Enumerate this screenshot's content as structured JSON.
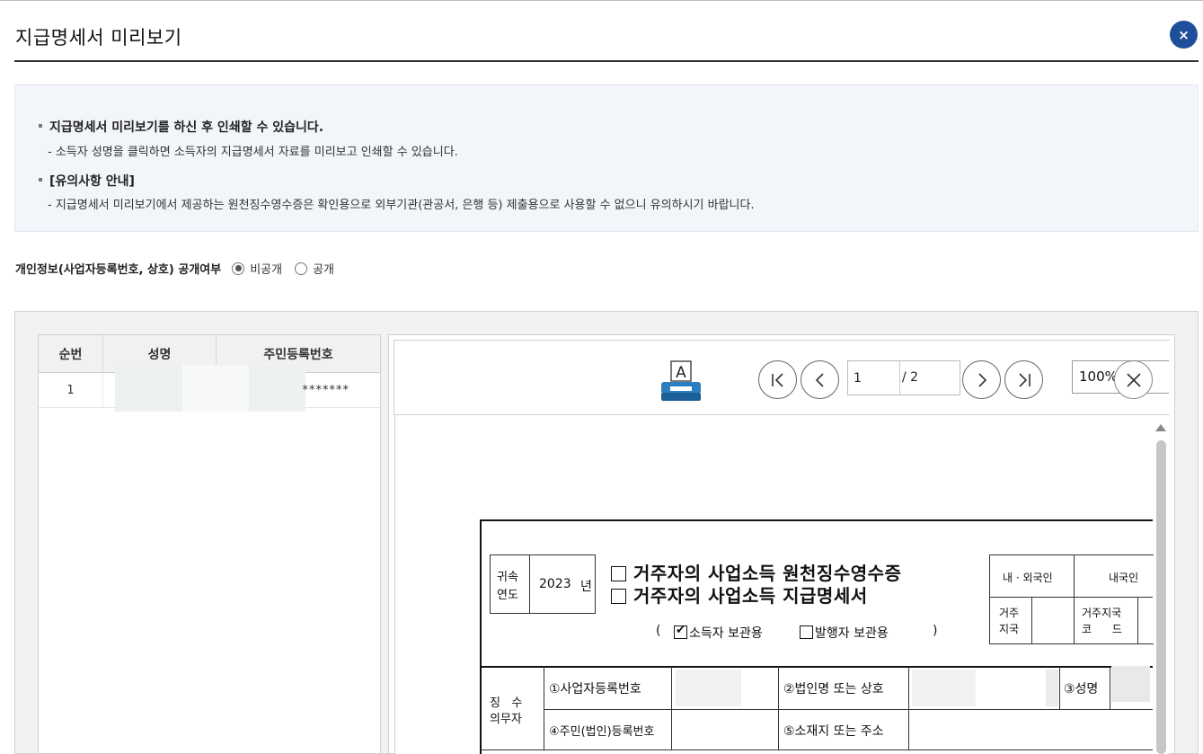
{
  "dialog": {
    "title": "지급명세서 미리보기",
    "close_label": "×"
  },
  "info": {
    "line1": "지급명세서 미리보기를 하신 후 인쇄할 수 있습니다.",
    "line2": "- 소득자 성명을 클릭하면 소득자의 지급명세서 자료를 미리보고 인쇄할 수 있습니다.",
    "line3": "[유의사항 안내]",
    "line4": "- 지급명세서 미리보기에서 제공하는 원천징수영수증은 확인용으로 외부기관(관공서, 은행 등) 제출용으로 사용할 수 없으니 유의하시기 바랍니다."
  },
  "privacy": {
    "label": "개인정보(사업자등록번호, 상호) 공개여부",
    "options": [
      {
        "label": "비공개",
        "selected": true
      },
      {
        "label": "공개",
        "selected": false
      }
    ]
  },
  "list": {
    "headers": [
      "순번",
      "성명",
      "주민등록번호"
    ],
    "rows": [
      {
        "no": "1",
        "name": "",
        "rrn": "*******"
      }
    ]
  },
  "viewer": {
    "page_current": "1",
    "page_total": "/ 2",
    "zoom": "100%",
    "print_icon": "print-icon",
    "print_icon_letter": "A"
  },
  "document": {
    "year_label_1": "귀속",
    "year_label_2": "연도",
    "year": "2023",
    "year_unit": "년",
    "title1": "거주자의 사업소득 원천징수영수증",
    "title2": "거주자의 사업소득 지급명세서",
    "copy_open": "(",
    "copy_close": ")",
    "copy_recipient": "소득자 보관용",
    "copy_issuer": "발행자 보관용",
    "nationality_label": "내 · 외국인",
    "nationality_value": "내국인",
    "residence_label_1": "거주",
    "residence_label_2": "지국",
    "residence_code_label_1": "거주지국",
    "residence_code_label_2": "코      드",
    "payer_label_1": "징   수",
    "payer_label_2": "의무자",
    "field_biz_no": "①사업자등록번호",
    "field_corp_name": "②법인명 또는 상호",
    "field_name": "③성명",
    "field_rrn": "④주민(법인)등록번호",
    "field_address": "⑤소재지 또는 주소"
  },
  "colors": {
    "accent": "#1f4f9a",
    "info_bg": "#f2f5fa",
    "header_bg": "#f1f1f1"
  }
}
